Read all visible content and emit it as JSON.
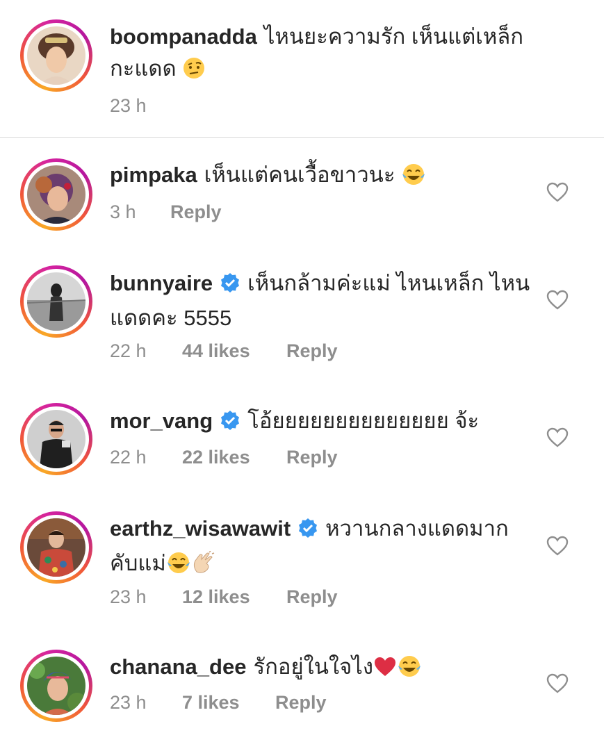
{
  "caption": {
    "username": "boompanadda",
    "text": "ไหนยะความรัก เห็นแต่เหล็ก กะแดด",
    "emoji": "face-with-raised-eyebrow",
    "time": "23 h"
  },
  "comments": [
    {
      "username": "pimpaka",
      "verified": false,
      "text": "เห็นแต่คนเวื้อขาวนะ",
      "emoji": [
        "tears-of-joy"
      ],
      "time": "3 h",
      "likes": "",
      "reply": "Reply"
    },
    {
      "username": "bunnyaire",
      "verified": true,
      "text": "เห็นกล้ามค่ะแม่ ไหนเหล็ก ไหนแดดคะ 5555",
      "emoji": [],
      "time": "22 h",
      "likes": "44 likes",
      "reply": "Reply"
    },
    {
      "username": "mor_vang",
      "verified": true,
      "text": "โอ้ยยยยยยยยยยยยยย จ้ะ",
      "emoji": [],
      "time": "22 h",
      "likes": "22 likes",
      "reply": "Reply"
    },
    {
      "username": "earthz_wisawawit",
      "verified": true,
      "text": "หวานกลางแดดมาก คับแม่",
      "emoji": [
        "tears-of-joy",
        "clapping-hands"
      ],
      "time": "23 h",
      "likes": "12 likes",
      "reply": "Reply"
    },
    {
      "username": "chanana_dee",
      "verified": false,
      "text": "รักอยู่ในใจไง",
      "emoji": [
        "red-heart",
        "tears-of-joy"
      ],
      "time": "23 h",
      "likes": "7 likes",
      "reply": "Reply"
    }
  ],
  "colors": {
    "text": "#262626",
    "meta": "#8e8e8e",
    "verified": "#3897f0",
    "divider": "#dbdbdb"
  }
}
